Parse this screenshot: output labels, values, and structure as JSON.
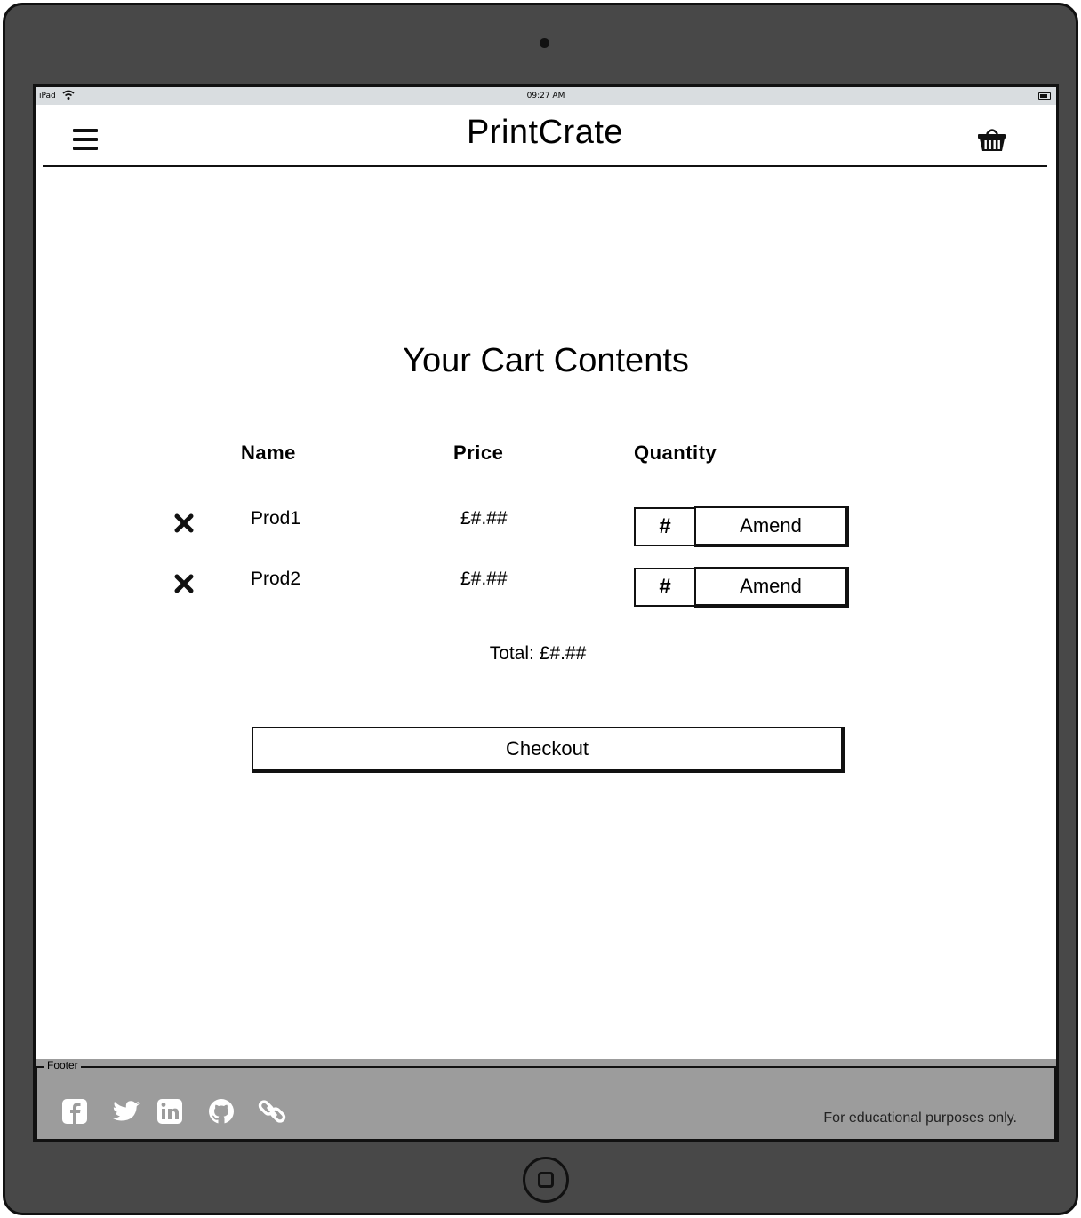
{
  "status_bar": {
    "device": "iPad",
    "time": "09:27 AM"
  },
  "header": {
    "brand": "PrintCrate"
  },
  "cart": {
    "title": "Your Cart Contents",
    "columns": {
      "name": "Name",
      "price": "Price",
      "quantity": "Quantity"
    },
    "items": [
      {
        "name": "Prod1",
        "price": "£#.##",
        "quantity": "#",
        "amend_label": "Amend"
      },
      {
        "name": "Prod2",
        "price": "£#.##",
        "quantity": "#",
        "amend_label": "Amend"
      }
    ],
    "total_label": "Total: £#.##",
    "checkout_label": "Checkout"
  },
  "footer": {
    "label": "Footer",
    "note": "For educational purposes only.",
    "icons": [
      "facebook-icon",
      "twitter-icon",
      "linkedin-icon",
      "github-icon",
      "link-icon"
    ]
  }
}
